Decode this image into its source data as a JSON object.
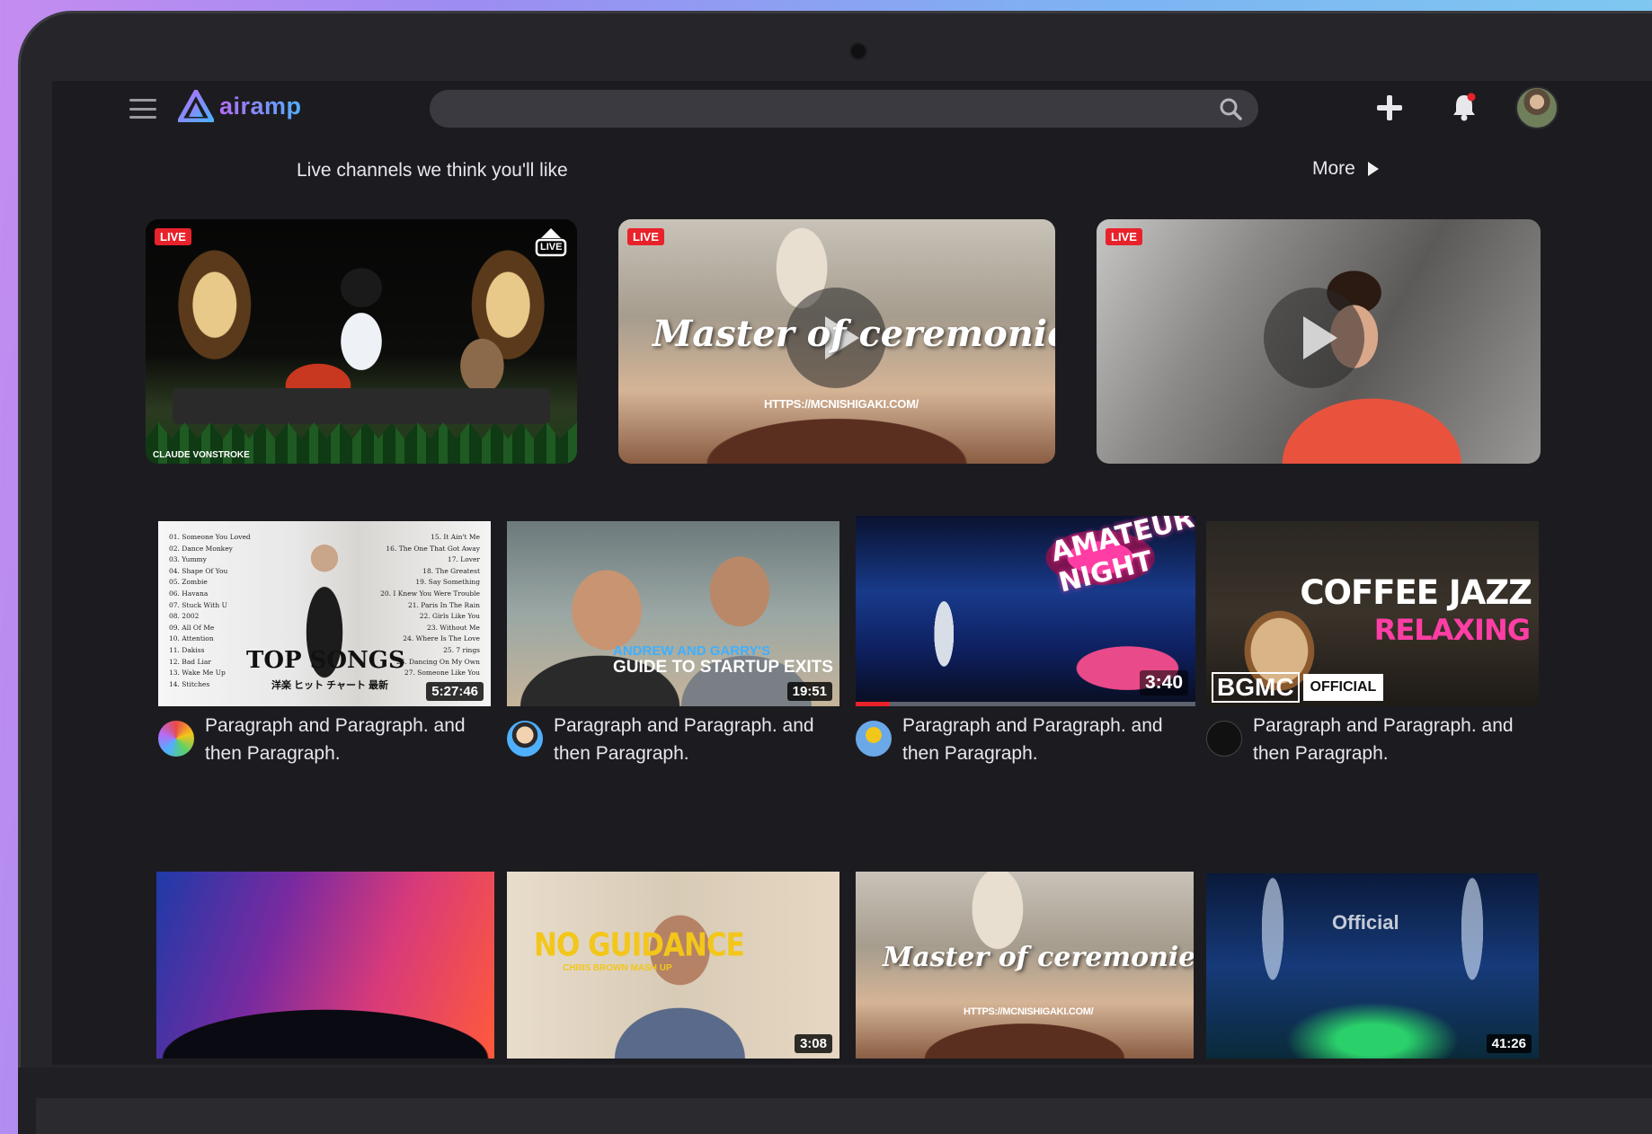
{
  "app": {
    "name": "airamp"
  },
  "search": {
    "placeholder": ""
  },
  "section": {
    "title": "Live channels we think you'll like",
    "more_label": "More"
  },
  "live_cards": [
    {
      "badge": "LIVE",
      "corner_badge": "LIVE",
      "credit": "CLAUDE VONSTROKE"
    },
    {
      "badge": "LIVE",
      "overlay_title": "Master of ceremonies",
      "overlay_url": "HTTPS://MCNISHIGAKI.COM/"
    },
    {
      "badge": "LIVE"
    }
  ],
  "videos": [
    {
      "duration": "5:27:46",
      "title": "TOP SONGS",
      "subtitle": "洋楽 ヒット チャート 最新",
      "tracklist_left": [
        "01. Someone You Loved",
        "02. Dance Monkey",
        "03. Yummy",
        "04. Shape Of You",
        "05. Zombie",
        "06. Havana",
        "07. Stuck With U",
        "08. 2002",
        "09. All Of Me",
        "10. Attention",
        "11. Dakiss",
        "12. Bad Liar",
        "13. Wake Me Up",
        "14. Stitches"
      ],
      "tracklist_right": [
        "15. It Ain't Me",
        "16. The One That Got Away",
        "17. Lover",
        "18. The Greatest",
        "19. Say Something",
        "20. I Knew You Were Trouble",
        "21. Paris In The Rain",
        "22. Girls Like You",
        "23. Without Me",
        "24. Where Is The Love",
        "25. 7 rings",
        "26. Dancing On My Own",
        "27. Someone Like You"
      ],
      "description": "Paragraph and Paragraph. and then Paragraph."
    },
    {
      "duration": "19:51",
      "overlay_line1": "ANDREW AND GARRY'S",
      "overlay_line2": "GUIDE TO STARTUP EXITS",
      "description": "Paragraph and Paragraph. and then Paragraph."
    },
    {
      "duration": "3:40",
      "sign_text": "AMATEUR NIGHT",
      "progress": 0.1,
      "description": "Paragraph and Paragraph. and then Paragraph."
    },
    {
      "overlay_line1": "COFFEE JAZZ",
      "overlay_line2": "RELAXING",
      "channel_logo": "BGMC",
      "channel_badge": "OFFICIAL",
      "description": "Paragraph and Paragraph. and then Paragraph."
    }
  ],
  "videos_row2": [
    {},
    {
      "duration": "3:08",
      "overlay_line1": "NO GUIDANCE",
      "overlay_line2": "CHRIS BROWN MASH UP"
    },
    {
      "overlay_title": "Master of ceremonies",
      "overlay_url": "HTTPS://MCNISHIGAKI.COM/"
    },
    {
      "duration": "41:26",
      "overlay_text": "Official"
    }
  ],
  "colors": {
    "accent": "#e8222b",
    "brand_gradient": [
      "#b46cf6",
      "#4fb0ff"
    ],
    "background": "#1c1c20"
  },
  "icons": [
    "menu-icon",
    "logo-icon",
    "search-icon",
    "plus-icon",
    "bell-icon",
    "play-icon",
    "live-icon"
  ]
}
